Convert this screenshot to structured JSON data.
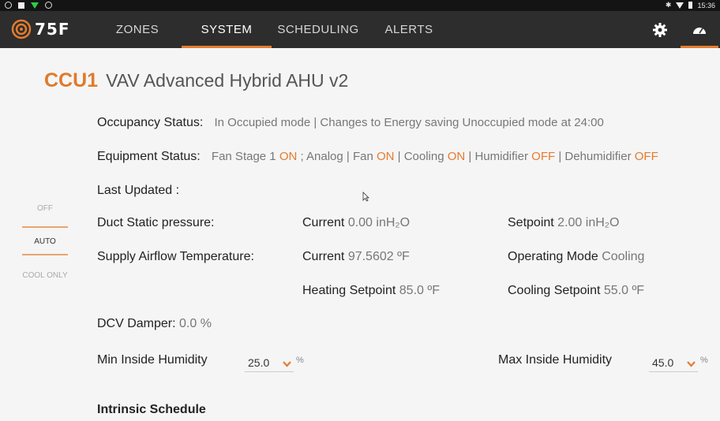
{
  "statusbar": {
    "time": "15:36"
  },
  "nav": {
    "logo_text": "75F",
    "tabs": [
      "ZONES",
      "SYSTEM",
      "SCHEDULING",
      "ALERTS"
    ],
    "active_tab": "SYSTEM",
    "accent": "#e57b2e"
  },
  "title": {
    "ccu": "CCU1",
    "name": "VAV Advanced Hybrid AHU v2"
  },
  "occupancy": {
    "label": "Occupancy Status:",
    "value": "In Occupied mode | Changes to Energy saving Unoccupied mode at 24:00"
  },
  "equipment": {
    "label": "Equipment Status:",
    "parts": [
      {
        "text": "Fan Stage 1 ",
        "state": "ON"
      },
      {
        "text": " ; Analog | Fan ",
        "state": "ON"
      },
      {
        "text": " | Cooling ",
        "state": "ON"
      },
      {
        "text": " | Humidifier ",
        "state": "OFF"
      },
      {
        "text": " | Dehumidifier ",
        "state": "OFF"
      }
    ]
  },
  "last_updated": {
    "label": "Last Updated :"
  },
  "modes": [
    "OFF",
    "AUTO",
    "COOL ONLY"
  ],
  "selected_mode": "AUTO",
  "duct": {
    "label": "Duct Static pressure:",
    "current_label": "Current",
    "current_value": "0.00 inH₂O",
    "setpoint_label": "Setpoint",
    "setpoint_value": "2.00 inH₂O"
  },
  "supply": {
    "label": "Supply Airflow Temperature:",
    "current_label": "Current",
    "current_value": "97.5602 ºF",
    "mode_label": "Operating Mode",
    "mode_value": "Cooling",
    "heating_label": "Heating Setpoint",
    "heating_value": "85.0 ºF",
    "cooling_label": "Cooling Setpoint",
    "cooling_value": "55.0 ºF"
  },
  "dcv": {
    "label": "DCV Damper:",
    "value": "0.0 %"
  },
  "humidity": {
    "min_label": "Min Inside Humidity",
    "min_value": "25.0",
    "max_label": "Max Inside Humidity",
    "max_value": "45.0",
    "unit": "%"
  },
  "intrinsic": {
    "label": "Intrinsic Schedule"
  }
}
